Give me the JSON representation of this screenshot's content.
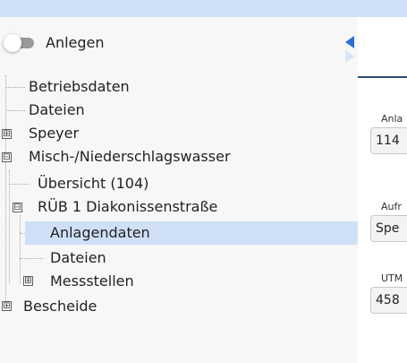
{
  "toggle": {
    "label": "Anlegen",
    "on": false
  },
  "tree": {
    "items": [
      {
        "label": "Betriebsdaten"
      },
      {
        "label": "Dateien"
      },
      {
        "label": "Speyer",
        "expander": "⊞"
      },
      {
        "label": "Misch-/Niederschlagswasser",
        "expander": "⊟"
      },
      {
        "label": "Übersicht (104)"
      },
      {
        "label": "RÜB 1 Diakonissenstraße",
        "expander": "⊟"
      },
      {
        "label": "Anlagendaten",
        "selected": true
      },
      {
        "label": "Dateien"
      },
      {
        "label": "Messstellen",
        "expander": "⊞"
      },
      {
        "label": "Bescheide",
        "expander": "⊞"
      }
    ]
  },
  "form": {
    "fields": [
      {
        "label": "Anla",
        "value": "114"
      },
      {
        "label": "Aufr",
        "value": "Spe"
      },
      {
        "label": "UTM",
        "value": "458"
      }
    ]
  },
  "colors": {
    "selection": "#cfe0f6",
    "accent_rule": "#2c4c80",
    "collapse_arrow": "#2a6fd6"
  },
  "icons": {
    "collapse": "chevron-left-icon",
    "expand": "plus-box-icon",
    "collapse_node": "minus-box-icon"
  }
}
